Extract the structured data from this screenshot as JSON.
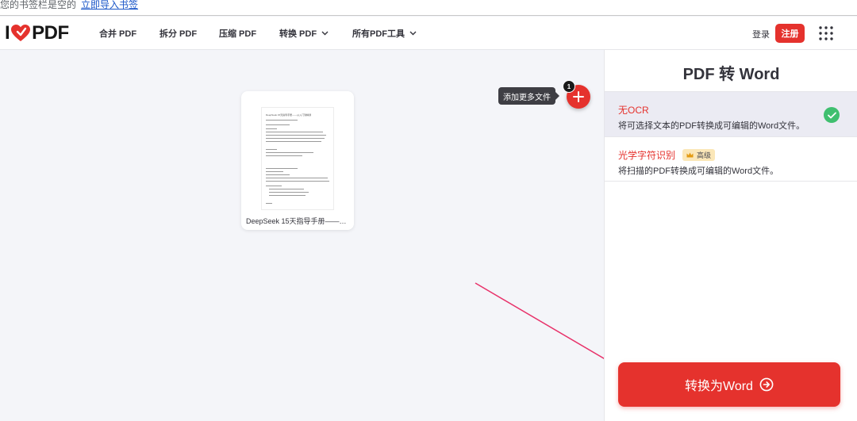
{
  "bookmarks": {
    "empty_text": "您的书签栏是空的",
    "import_link": "立即导入书签"
  },
  "header": {
    "logo_left": "I",
    "logo_right": "PDF",
    "nav": [
      {
        "label": "合并 PDF"
      },
      {
        "label": "拆分 PDF"
      },
      {
        "label": "压缩 PDF"
      },
      {
        "label": "转换 PDF"
      },
      {
        "label": "所有PDF工具"
      }
    ],
    "login": "登录",
    "signup": "注册"
  },
  "file": {
    "thumbnail_title": "DeepSeek 15天指导手册——从入门到精通",
    "name": "DeepSeek 15天指导手册——从..."
  },
  "add_files": {
    "tooltip": "添加更多文件",
    "count": "1"
  },
  "sidebar": {
    "title": "PDF 转 Word",
    "options": [
      {
        "title": "无OCR",
        "description": "将可选择文本的PDF转换成可编辑的Word文件。",
        "selected": true
      },
      {
        "title": "光学字符识别",
        "description": "将扫描的PDF转换成可编辑的Word文件。",
        "badge": "高级"
      }
    ],
    "convert_button": "转换为Word"
  },
  "colors": {
    "accent": "#e5322d",
    "success": "#3fbf6f",
    "premium_badge": "#fbe7b8"
  }
}
